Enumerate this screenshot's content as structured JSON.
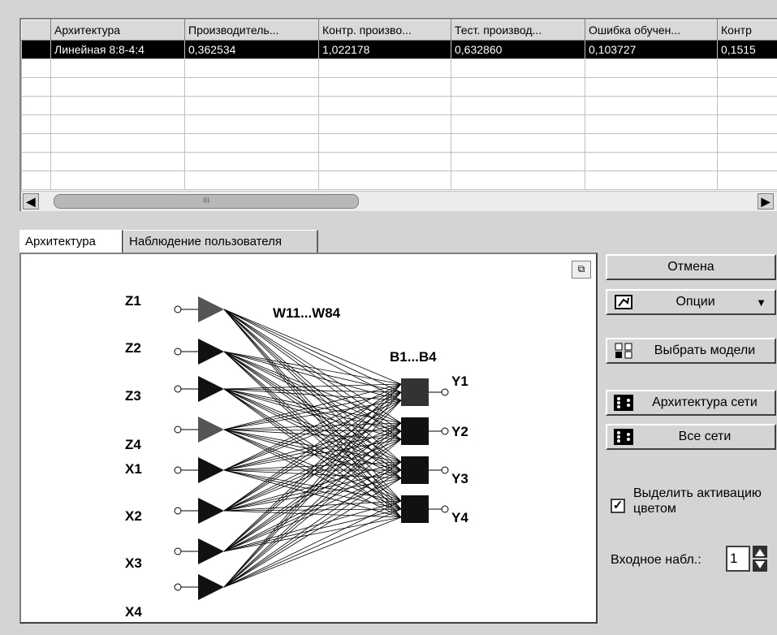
{
  "grid": {
    "columns": [
      "Архитектура",
      "Производитель...",
      "Контр. произво...",
      "Тест. производ...",
      "Ошибка обучен...",
      "Контр"
    ],
    "rows": [
      [
        "Линейная 8:8-4:4",
        "0,362534",
        "1,022178",
        "0,632860",
        "0,103727",
        "0,1515"
      ]
    ],
    "scroll_thumb_label": "III",
    "scroll_left_icon": "chevron-left-icon",
    "scroll_right_icon": "chevron-right-icon"
  },
  "tabs": [
    {
      "label": "Архитектура",
      "active": true
    },
    {
      "label": "Наблюдение пользователя",
      "active": false
    }
  ],
  "diagram": {
    "inputs": [
      "Z1",
      "Z2",
      "Z3",
      "Z4",
      "X1",
      "X2",
      "X3",
      "X4"
    ],
    "weights_label": "W11...W84",
    "bias_label": "B1...B4",
    "outputs": [
      "Y1",
      "Y2",
      "Y3",
      "Y4"
    ]
  },
  "buttons": {
    "cancel": "Отмена",
    "options": "Опции",
    "select_models": "Выбрать модели",
    "network_architecture": "Архитектура сети",
    "all_networks": "Все сети"
  },
  "highlight": {
    "label": "Выделить активацию цветом",
    "checked": true
  },
  "input_case": {
    "label": "Входное набл.:",
    "value": "1"
  }
}
